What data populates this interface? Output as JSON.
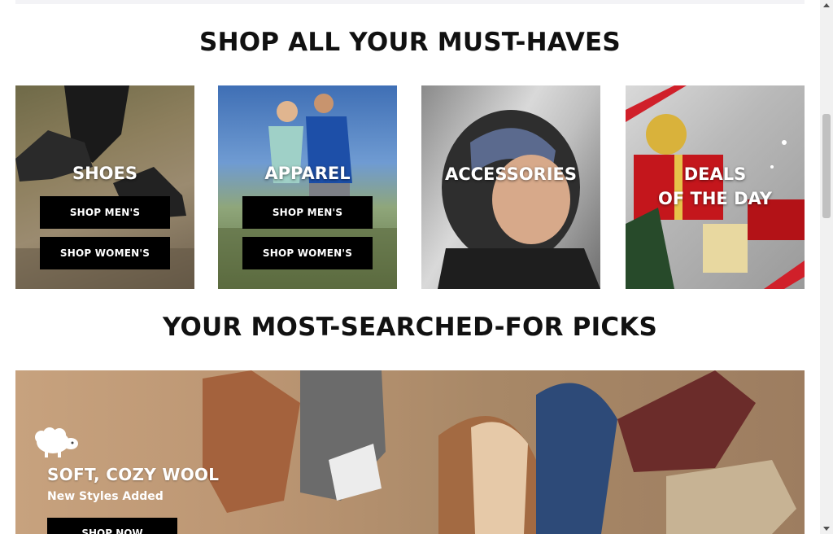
{
  "headings": {
    "must_haves": "SHOP ALL YOUR MUST-HAVES",
    "most_searched": "YOUR MOST-SEARCHED-FOR PICKS"
  },
  "tiles": [
    {
      "label": "SHOES",
      "men_button": "SHOP MEN'S",
      "women_button": "SHOP WOMEN'S"
    },
    {
      "label": "APPAREL",
      "men_button": "SHOP MEN'S",
      "women_button": "SHOP WOMEN'S"
    },
    {
      "label": "ACCESSORIES"
    },
    {
      "label_line1": "DEALS",
      "label_line2": "OF THE DAY"
    }
  ],
  "banner": {
    "title": "SOFT, COZY WOOL",
    "subtitle": "New Styles Added",
    "button": "SHOP NOW",
    "icon": "sheep-icon"
  },
  "colors": {
    "button_bg": "#000000",
    "heading": "#111111",
    "deals_red": "#d0202a"
  }
}
